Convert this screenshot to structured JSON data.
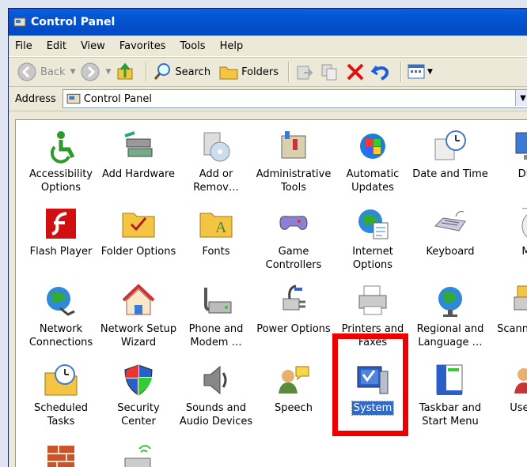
{
  "window": {
    "title": "Control Panel"
  },
  "menu": [
    "File",
    "Edit",
    "View",
    "Favorites",
    "Tools",
    "Help"
  ],
  "toolbar": {
    "back": "Back",
    "search": "Search",
    "folders": "Folders"
  },
  "address": {
    "label": "Address",
    "value": "Control Panel"
  },
  "items": [
    {
      "label": "Accessibility Options",
      "icon": "accessibility-icon"
    },
    {
      "label": "Add Hardware",
      "icon": "add-hardware-icon"
    },
    {
      "label": "Add or Remov…",
      "icon": "add-remove-programs-icon"
    },
    {
      "label": "Administrative Tools",
      "icon": "admin-tools-icon"
    },
    {
      "label": "Automatic Updates",
      "icon": "automatic-updates-icon"
    },
    {
      "label": "Date and Time",
      "icon": "date-time-icon"
    },
    {
      "label": "Disp",
      "icon": "display-icon"
    },
    {
      "label": "Flash Player",
      "icon": "flash-icon"
    },
    {
      "label": "Folder Options",
      "icon": "folder-options-icon"
    },
    {
      "label": "Fonts",
      "icon": "fonts-icon"
    },
    {
      "label": "Game Controllers",
      "icon": "game-controller-icon"
    },
    {
      "label": "Internet Options",
      "icon": "internet-options-icon"
    },
    {
      "label": "Keyboard",
      "icon": "keyboard-icon"
    },
    {
      "label": "Mo",
      "icon": "mouse-icon"
    },
    {
      "label": "Network Connections",
      "icon": "network-icon"
    },
    {
      "label": "Network Setup Wizard",
      "icon": "network-setup-icon"
    },
    {
      "label": "Phone and Modem …",
      "icon": "phone-modem-icon"
    },
    {
      "label": "Power Options",
      "icon": "power-icon"
    },
    {
      "label": "Printers and Faxes",
      "icon": "printer-icon"
    },
    {
      "label": "Regional and Language …",
      "icon": "regional-icon"
    },
    {
      "label": "Scanne Cam",
      "icon": "scanner-icon"
    },
    {
      "label": "Scheduled Tasks",
      "icon": "scheduled-tasks-icon"
    },
    {
      "label": "Security Center",
      "icon": "security-center-icon"
    },
    {
      "label": "Sounds and Audio Devices",
      "icon": "sounds-icon"
    },
    {
      "label": "Speech",
      "icon": "speech-icon"
    },
    {
      "label": "System",
      "icon": "system-icon",
      "selected": true
    },
    {
      "label": "Taskbar and Start Menu",
      "icon": "taskbar-icon"
    },
    {
      "label": "User Ac",
      "icon": "user-accounts-icon"
    },
    {
      "label": "",
      "icon": "firewall-icon"
    },
    {
      "label": "",
      "icon": "wireless-icon"
    }
  ],
  "colors": {
    "titlebar": "#0453d0",
    "selection": "#316ac5",
    "highlight": "#e00000"
  }
}
